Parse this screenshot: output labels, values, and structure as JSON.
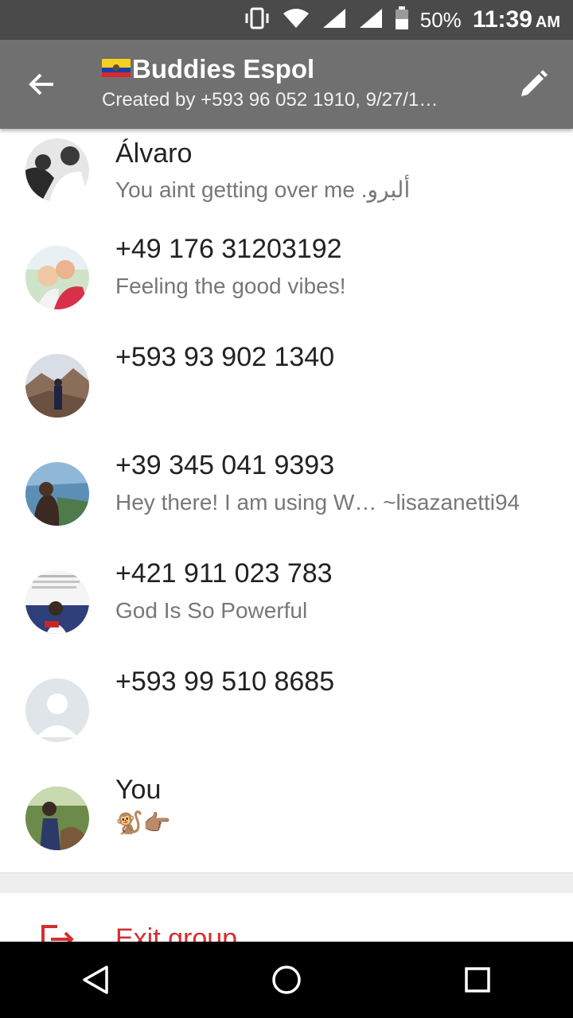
{
  "status_bar": {
    "battery": "50%",
    "time": "11:39",
    "ampm": "AM"
  },
  "header": {
    "title": "Buddies Espol",
    "subtitle": "Created by +593 96 052 1910, 9/27/1…",
    "flag_icon": "ecuador-flag-icon"
  },
  "participants": [
    {
      "name": "Álvaro",
      "status": "You aint getting over me .ألبرو"
    },
    {
      "name": "+49 176 31203192",
      "status": "Feeling the good vibes!"
    },
    {
      "name": "+593 93 902 1340",
      "status": ""
    },
    {
      "name": "+39 345 041 9393",
      "status": "Hey there! I am using W… ~lisazanetti94"
    },
    {
      "name": "+421 911 023 783",
      "status": "God Is So Powerful"
    },
    {
      "name": "+593 99 510 8685",
      "status": ""
    },
    {
      "name": "You",
      "status": "🐒👉🏽"
    }
  ],
  "exit": {
    "label": "Exit group"
  },
  "colors": {
    "appbar": "#707070",
    "statusbar": "#4a4a4a",
    "exit": "#d32f2f"
  }
}
